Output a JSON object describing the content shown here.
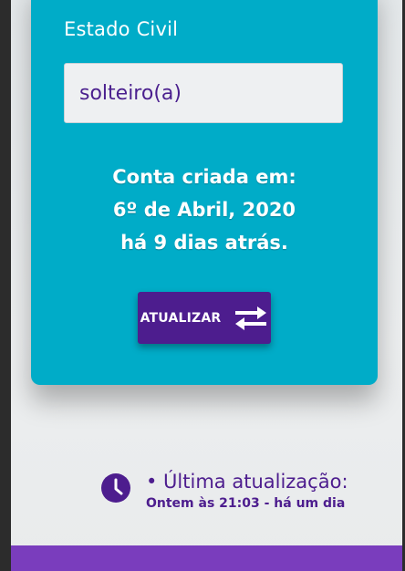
{
  "profile": {
    "marital_status_label": "Estado Civil",
    "marital_status_value": "solteiro(a)"
  },
  "account": {
    "created_line": "Conta criada em:",
    "created_date": "6º de Abril, 2020",
    "created_ago": "há 9 dias atrás."
  },
  "actions": {
    "update_label": "ATUALIZAR",
    "update_icon": "swap-arrows-icon"
  },
  "last_update": {
    "icon": "clock-icon",
    "title": "• Última atualização:",
    "detail": "Ontem às 21:03 - há um dia"
  },
  "colors": {
    "card": "#00acc8",
    "accent": "#4d1d8e",
    "bottom_bar": "#7a3dbd",
    "page_bg": "#eceeef"
  }
}
